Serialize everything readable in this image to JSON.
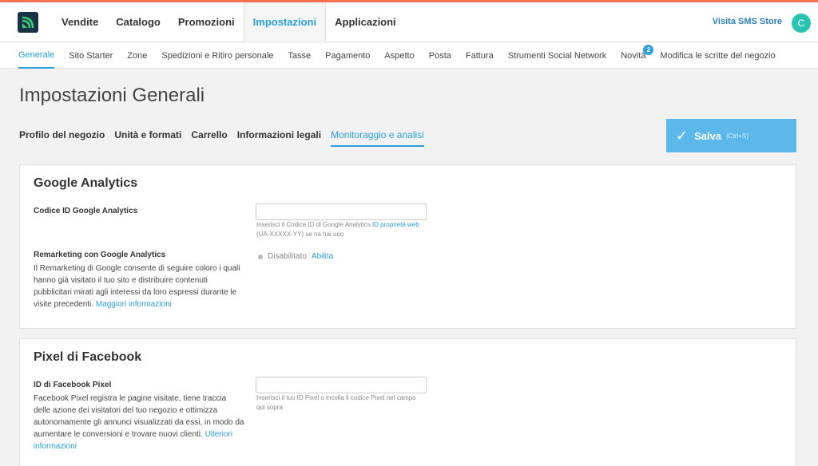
{
  "header": {
    "nav": [
      "Vendite",
      "Catalogo",
      "Promozioni",
      "Impostazioni",
      "Applicazioni"
    ],
    "store_link": "Visita SMS Store",
    "avatar_initial": "C"
  },
  "subnav": {
    "items": [
      "Generale",
      "Sito Starter",
      "Zone",
      "Spedizioni e Ritiro personale",
      "Tasse",
      "Pagamento",
      "Aspetto",
      "Posta",
      "Fattura",
      "Strumenti Social Network",
      "Novità",
      "Modifica le scritte del negozio"
    ],
    "badge_count": "2"
  },
  "page": {
    "title": "Impostazioni Generali",
    "tabs": [
      "Profilo del negozio",
      "Unità e formati",
      "Carrello",
      "Informazioni legali",
      "Monitoraggio e analisi"
    ],
    "save_label": "Salva",
    "save_shortcut": "(Ctrl+S)"
  },
  "google_analytics": {
    "title": "Google Analytics",
    "code_label": "Codice ID Google Analytics",
    "code_hint_prefix": "Inserisci il Codice ID di Google Analytics,",
    "code_hint_link": "ID proprietà web",
    "code_hint_suffix": " (UA-XXXXX-YY) se na hai uoo",
    "remarketing_label": "Remarketing con Google Analytics",
    "remarketing_desc": "Il Remarketing di Google consente di seguire coloro i quali hanno già visitato il tuo sito e distribuire contenuti pubblicitari mirati agli interessi da loro espressi durante le visite precedenti. ",
    "remarketing_link": "Maggiori informazioni",
    "status": "Disabilitato",
    "enable_link": "Abilita"
  },
  "facebook": {
    "title": "Pixel di Facebook",
    "pixel_label": "ID di Facebook Pixel",
    "pixel_desc": "Facebook Pixel registra le pagine visitate, tiene traccia delle azione dei visitatori del tuo negozio e ottimizza autonomamente gli annunci visualizzati da essi, in modo da aumentare le conversioni e trovare nuovi clienti.",
    "pixel_link": "Ulteriori informazioni",
    "pixel_hint": "Inserisci il tuo ID Pixel o incolla il codice Pixel nel campo qui sopra"
  }
}
